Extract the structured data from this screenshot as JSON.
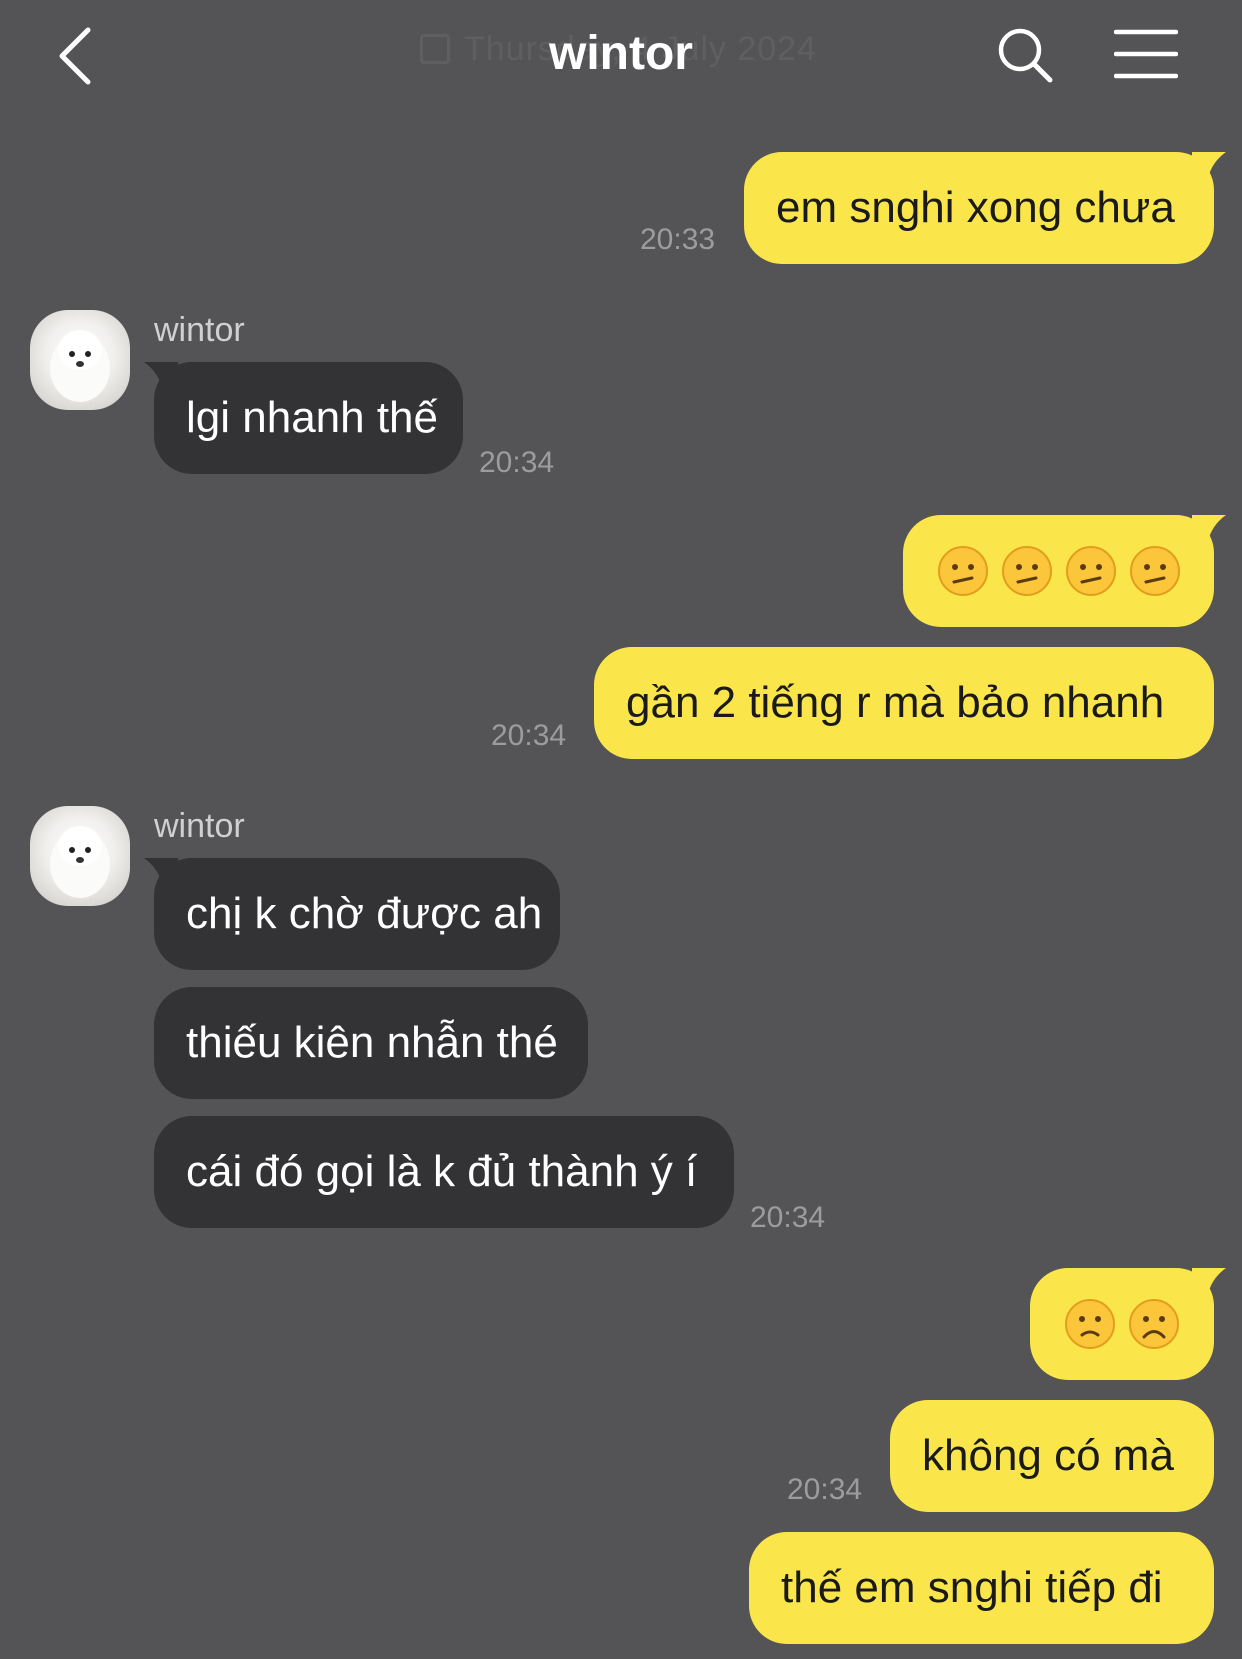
{
  "header": {
    "title": "wintor",
    "date_overlay": "Thursday, 4 July 2024",
    "back_icon": "chevron-left-icon",
    "search_icon": "search-icon",
    "menu_icon": "hamburger-menu-icon"
  },
  "colors": {
    "background": "#545355",
    "my_bubble": "#fae54a",
    "their_bubble": "#333235",
    "time_text": "#9c9b9d"
  },
  "messages": [
    {
      "from": "me",
      "text": "em snghi xong chưa",
      "time": "20:33"
    },
    {
      "from": "wintor",
      "sender_name": "wintor",
      "text": "lgi nhanh thế",
      "time": "20:34"
    },
    {
      "from": "me",
      "emojis": [
        "confused-face",
        "confused-face",
        "confused-face",
        "confused-face"
      ]
    },
    {
      "from": "me",
      "text": "gần 2 tiếng r mà bảo nhanh",
      "time": "20:34"
    },
    {
      "from": "wintor",
      "sender_name": "wintor",
      "text": "chị k chờ được ah"
    },
    {
      "from": "wintor",
      "text": "thiếu kiên nhẫn thé"
    },
    {
      "from": "wintor",
      "text": "cái đó gọi là k đủ thành ý í",
      "time": "20:34"
    },
    {
      "from": "me",
      "emojis": [
        "slightly-frowning-face",
        "frowning-face"
      ]
    },
    {
      "from": "me",
      "text": "không có mà",
      "time": "20:34"
    },
    {
      "from": "me",
      "text": "thế em snghi tiếp đi"
    }
  ]
}
